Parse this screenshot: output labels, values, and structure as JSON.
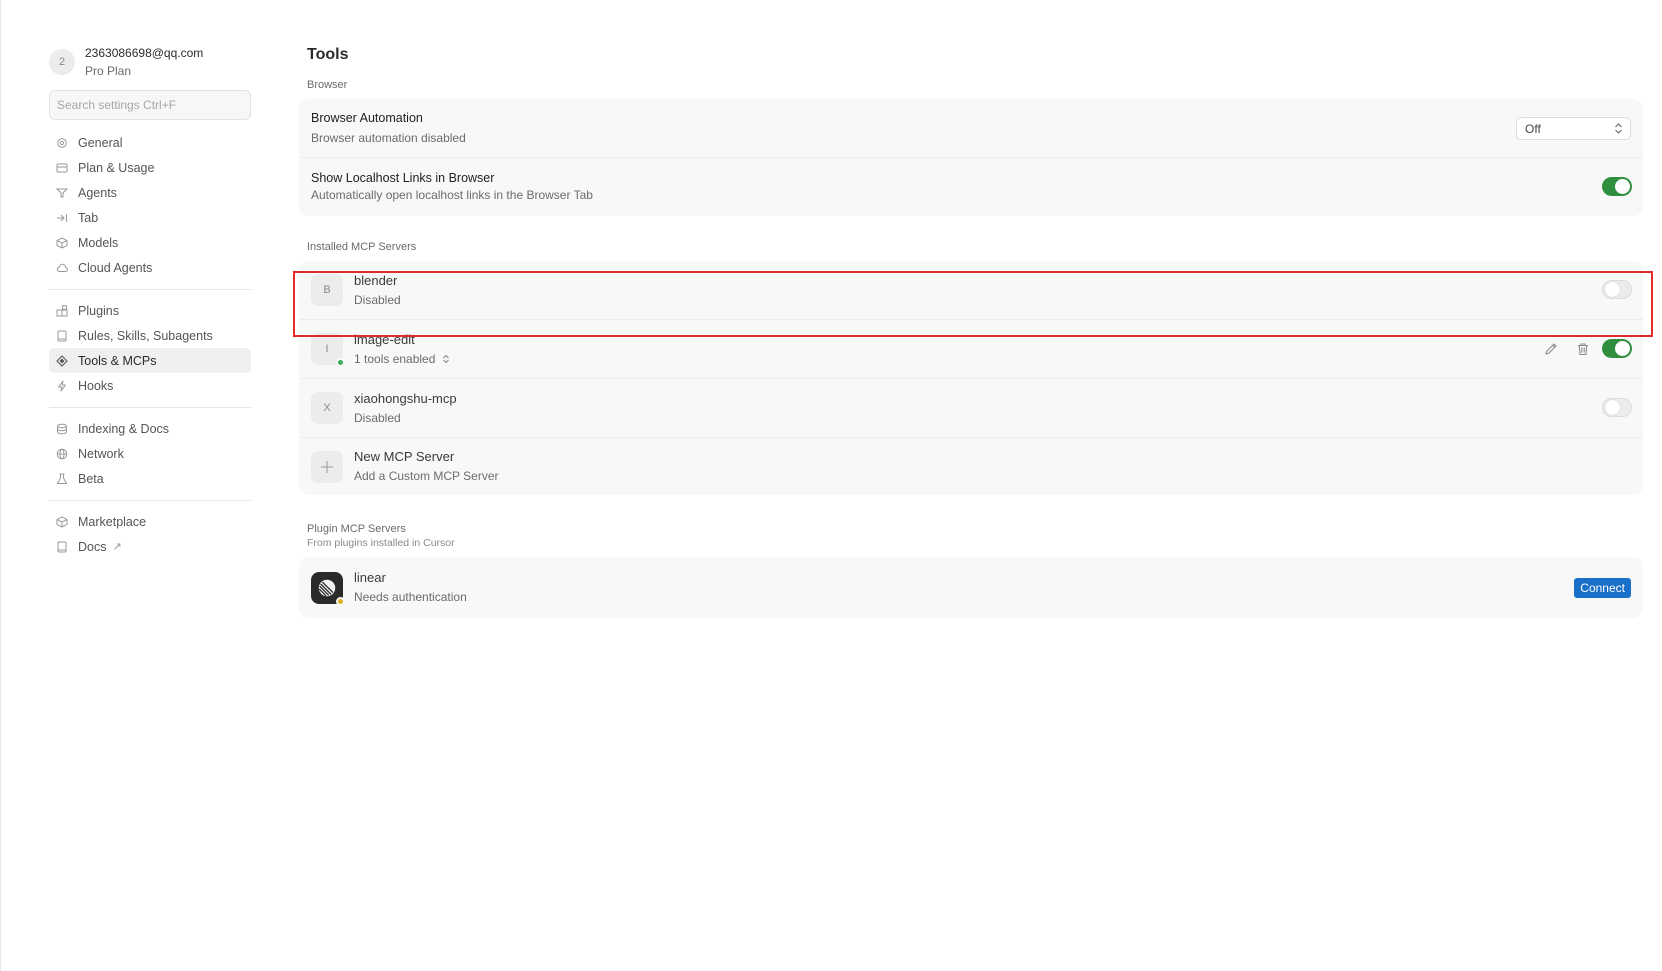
{
  "account": {
    "avatar_letter": "2",
    "email": "2363086698@qq.com",
    "plan": "Pro Plan"
  },
  "search": {
    "placeholder": "Search settings Ctrl+F"
  },
  "sidebar": {
    "group1": [
      {
        "label": "General",
        "icon": "gear-icon"
      },
      {
        "label": "Plan & Usage",
        "icon": "card-icon"
      },
      {
        "label": "Agents",
        "icon": "infinity-icon"
      },
      {
        "label": "Tab",
        "icon": "tab-arrow-icon"
      },
      {
        "label": "Models",
        "icon": "cube-icon"
      },
      {
        "label": "Cloud Agents",
        "icon": "cloud-icon"
      }
    ],
    "group2": [
      {
        "label": "Plugins",
        "icon": "plugin-icon"
      },
      {
        "label": "Rules, Skills, Subagents",
        "icon": "book-icon"
      },
      {
        "label": "Tools & MCPs",
        "icon": "tools-icon",
        "active": true
      },
      {
        "label": "Hooks",
        "icon": "lightning-icon"
      }
    ],
    "group3": [
      {
        "label": "Indexing & Docs",
        "icon": "database-icon"
      },
      {
        "label": "Network",
        "icon": "globe-icon"
      },
      {
        "label": "Beta",
        "icon": "flask-icon"
      }
    ],
    "group4": [
      {
        "label": "Marketplace",
        "icon": "cube-icon"
      },
      {
        "label": "Docs",
        "icon": "book-icon",
        "external_icon": "external-link-icon"
      }
    ]
  },
  "page": {
    "title": "Tools"
  },
  "browser": {
    "section_label": "Browser",
    "automation": {
      "title": "Browser Automation",
      "subtitle": "Browser automation disabled",
      "select_value": "Off"
    },
    "localhost": {
      "title": "Show Localhost Links in Browser",
      "subtitle": "Automatically open localhost links in the Browser Tab",
      "enabled": true
    }
  },
  "installed": {
    "section_label": "Installed MCP Servers",
    "servers": [
      {
        "letter": "B",
        "name": "blender",
        "status": "Disabled",
        "enabled": false,
        "highlighted": true
      },
      {
        "letter": "I",
        "name": "image-edit",
        "status": "1 tools enabled",
        "enabled": true,
        "status_dot_color": "#3fae5a"
      },
      {
        "letter": "X",
        "name": "xiaohongshu-mcp",
        "status": "Disabled",
        "enabled": false
      }
    ],
    "new_server": {
      "title": "New MCP Server",
      "subtitle": "Add a Custom MCP Server"
    }
  },
  "plugins": {
    "section_label": "Plugin MCP Servers",
    "section_sub": "From plugins installed in Cursor",
    "servers": [
      {
        "name": "linear",
        "status": "Needs authentication",
        "button": "Connect",
        "status_dot_color": "#e0b020"
      }
    ]
  },
  "colors": {
    "toggle_on": "#2f8f3f",
    "connect_button": "#1a6fc9",
    "highlight_border": "#e32a2a"
  }
}
